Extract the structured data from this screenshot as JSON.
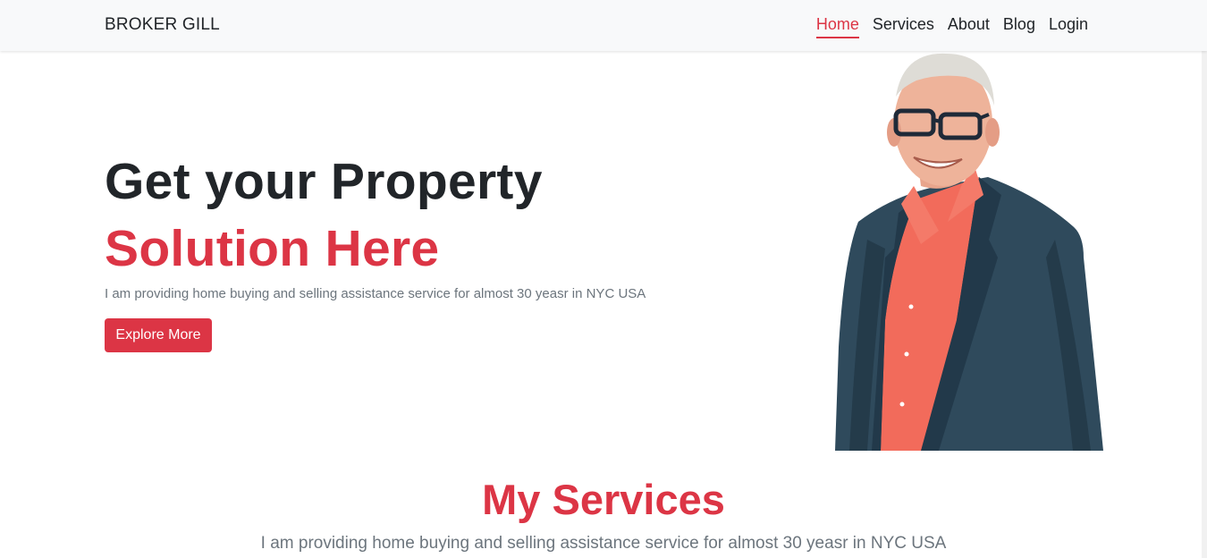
{
  "nav": {
    "brand": "BROKER GILL",
    "links": [
      "Home",
      "Services",
      "About",
      "Blog",
      "Login"
    ],
    "active": "Home"
  },
  "hero": {
    "title": "Get your Property",
    "title_accent": "Solution Here",
    "description": "I am providing home buying and selling assistance service for almost 30 yeasr in NYC USA",
    "button_label": "Explore More"
  },
  "services": {
    "title": "My Services",
    "description": "I am providing home buying and selling assistance service for almost 30 yeasr in NYC USA"
  },
  "colors": {
    "accent": "#dc3545",
    "navbar_bg": "#f8f9fa",
    "text_dark": "#212529",
    "text_muted": "#6c757d"
  }
}
